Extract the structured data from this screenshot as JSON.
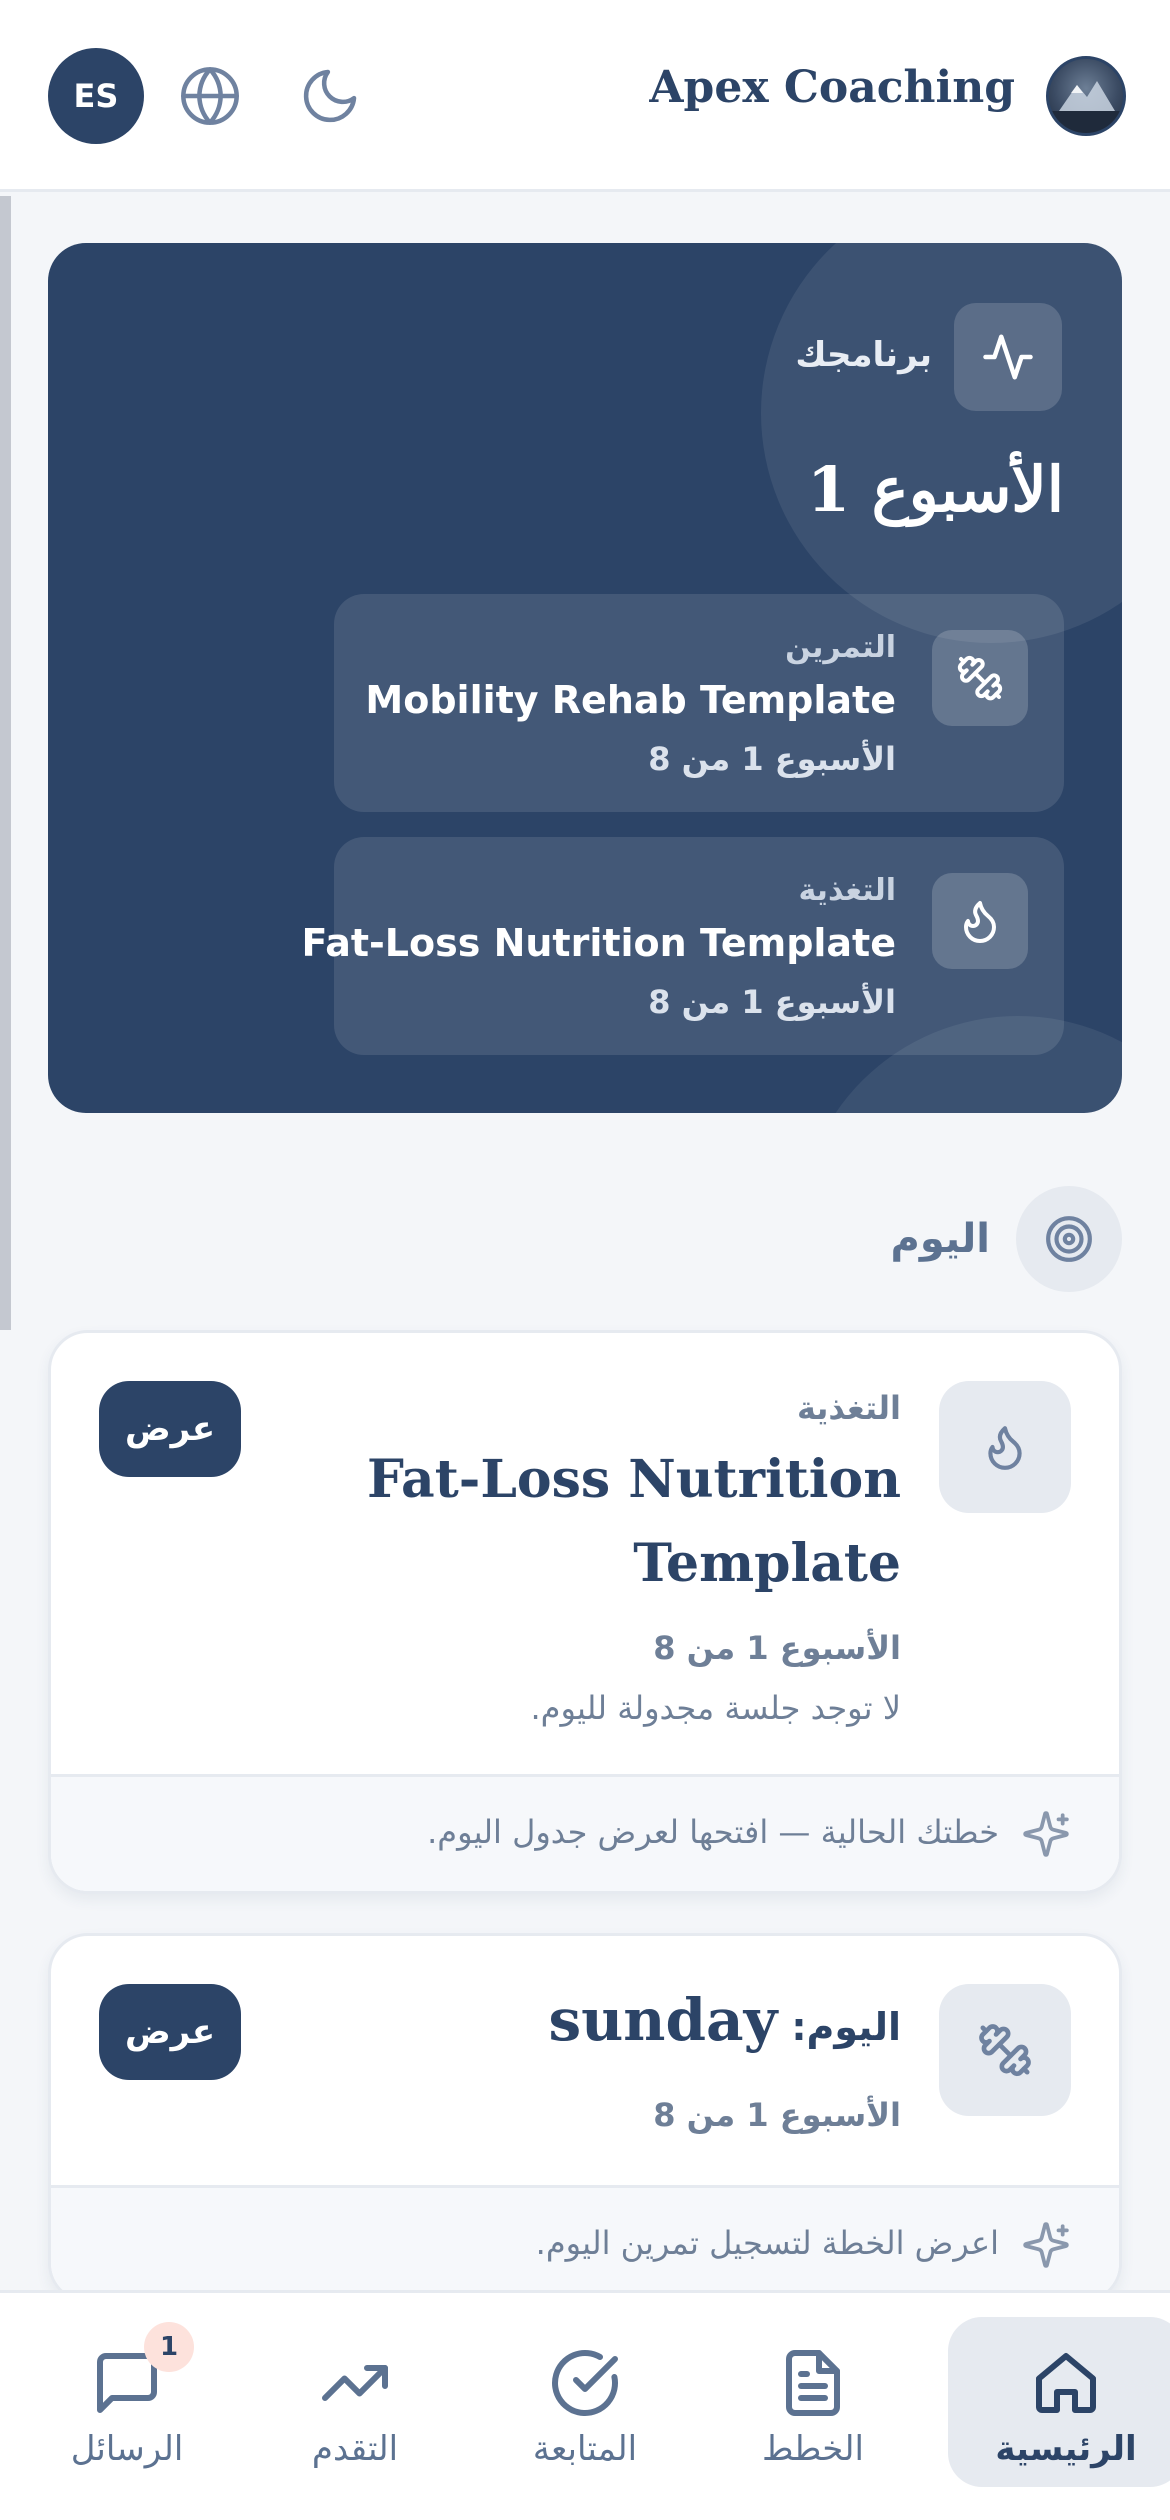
{
  "header": {
    "brand_title": "Apex Coaching",
    "language_code": "ES",
    "icons": {
      "language": "globe-icon",
      "theme": "moon-icon",
      "logo": "brand-logo"
    }
  },
  "program": {
    "label": "برنامجك",
    "week_title": "الأسبوع 1",
    "icon": "activity-pulse-icon",
    "items": [
      {
        "label": "التمرين",
        "name": "Mobility Rehab Template",
        "week": "الأسبوع 1 من 8",
        "icon": "dumbbell-icon"
      },
      {
        "label": "التغذية",
        "name": "Fat-Loss Nutrition Template",
        "week": "الأسبوع 1 من 8",
        "icon": "flame-icon"
      }
    ]
  },
  "today": {
    "label": "اليوم",
    "icon": "target-icon",
    "nutrition_card": {
      "category": "التغذية",
      "title_line1": "Fat-Loss Nutrition",
      "title_line2": "Template",
      "week": "الأسبوع 1 من 8",
      "note": "لا توجد جلسة مجدولة لليوم.",
      "view_label": "عرض",
      "footer": "خطتك الحالية — افتحها لعرض جدول اليوم.",
      "icon": "flame-icon"
    },
    "workout_card": {
      "day_prefix": "اليوم:",
      "day_name": "sunday",
      "week": "الأسبوع 1 من 8",
      "view_label": "عرض",
      "footer": "اعرض الخطة لتسجيل تمرين اليوم.",
      "icon": "dumbbell-icon"
    }
  },
  "nav": {
    "items": [
      {
        "label": "الرئيسية",
        "icon": "home-icon",
        "active": true
      },
      {
        "label": "الخطط",
        "icon": "document-icon",
        "active": false
      },
      {
        "label": "المتابعة",
        "icon": "check-circle-icon",
        "active": false
      },
      {
        "label": "التقدم",
        "icon": "trending-up-icon",
        "active": false
      },
      {
        "label": "الرسائل",
        "icon": "message-icon",
        "active": false,
        "badge": "1"
      }
    ]
  },
  "colors": {
    "primary": "#2c4467",
    "background": "#f4f6f9",
    "muted_text": "#5c7291",
    "badge": "#fde2dc"
  }
}
